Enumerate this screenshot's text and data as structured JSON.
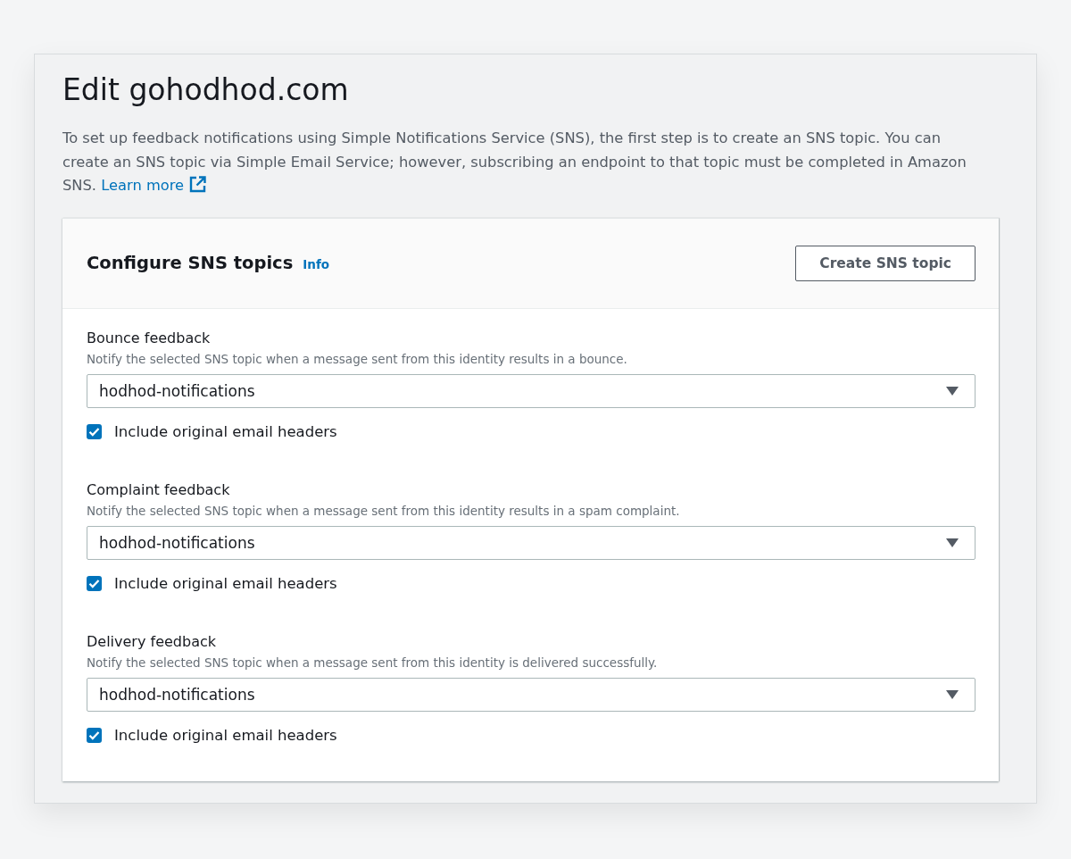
{
  "page": {
    "title": "Edit gohodhod.com",
    "description": "To set up feedback notifications using Simple Notifications Service (SNS), the first step is to create an SNS topic. You can create an SNS topic via Simple Email Service; however, subscribing an endpoint to that topic must be completed in Amazon SNS.",
    "learn_more": "Learn more"
  },
  "panel": {
    "title": "Configure SNS topics",
    "info_link": "Info",
    "create_button": "Create SNS topic",
    "feedback": [
      {
        "label": "Bounce feedback",
        "description": "Notify the selected SNS topic when a message sent from this identity results in a bounce.",
        "select_value": "hodhod-notifications",
        "checkbox": {
          "label": "Include original email headers",
          "checked": true
        }
      },
      {
        "label": "Complaint feedback",
        "description": "Notify the selected SNS topic when a message sent from this identity results in a spam complaint.",
        "select_value": "hodhod-notifications",
        "checkbox": {
          "label": "Include original email headers",
          "checked": true
        }
      },
      {
        "label": "Delivery feedback",
        "description": "Notify the selected SNS topic when a message sent from this identity is delivered successfully.",
        "select_value": "hodhod-notifications",
        "checkbox": {
          "label": "Include original email headers",
          "checked": true
        }
      }
    ]
  }
}
